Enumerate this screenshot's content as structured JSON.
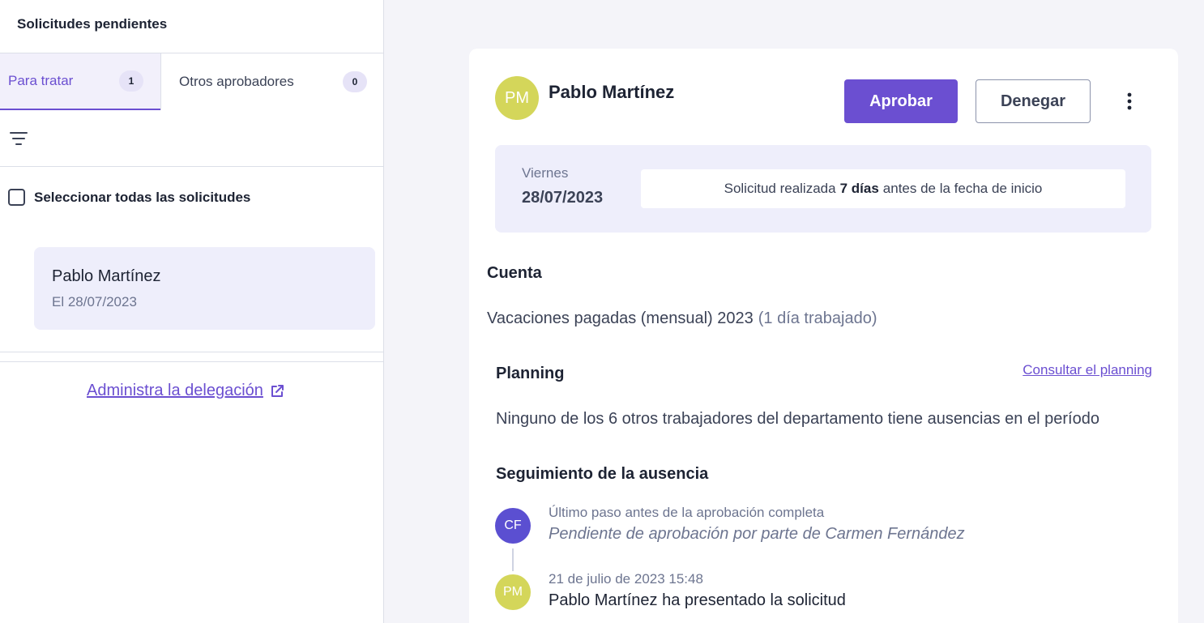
{
  "sidebar": {
    "title": "Solicitudes pendientes",
    "tabs": [
      {
        "label": "Para tratar",
        "count": "1"
      },
      {
        "label": "Otros aprobadores",
        "count": "0"
      }
    ],
    "select_all_label": "Seleccionar todas las solicitudes",
    "requests": [
      {
        "name": "Pablo Martínez",
        "date": "El 28/07/2023"
      }
    ],
    "delegation_link": "Administra la delegación"
  },
  "detail": {
    "avatar_initials": "PM",
    "name": "Pablo Martínez",
    "approve_label": "Aprobar",
    "deny_label": "Denegar",
    "day_name": "Viernes",
    "date": "28/07/2023",
    "info": {
      "prefix": "Solicitud realizada",
      "bold": "7 días",
      "suffix": "antes de la fecha de inicio"
    },
    "account_title": "Cuenta",
    "account_value": "Vacaciones pagadas (mensual) 2023",
    "account_extra": "(1 día trabajado)",
    "planning_title": "Planning",
    "planning_link": "Consultar el planning",
    "planning_text": "Ninguno de los 6 otros trabajadores del departamento tiene ausencias en el período",
    "tracking_title": "Seguimiento de la ausencia",
    "timeline": [
      {
        "initials": "CF",
        "sub": "Último paso antes de la aprobación completa",
        "main": "Pendiente de aprobación por parte de Carmen Fernández"
      },
      {
        "initials": "PM",
        "sub": "21 de julio de 2023 15:48",
        "main": "Pablo Martínez ha presentado la solicitud"
      }
    ]
  },
  "colors": {
    "accent": "#6b4fd1",
    "avatar_pm": "#d4d65a",
    "avatar_cf": "#5b4fd1",
    "highlight_bg": "#eeeefb"
  },
  "icons": {
    "filter": "filter-lines-icon",
    "external": "external-link-icon",
    "more": "vertical-dots-icon"
  }
}
